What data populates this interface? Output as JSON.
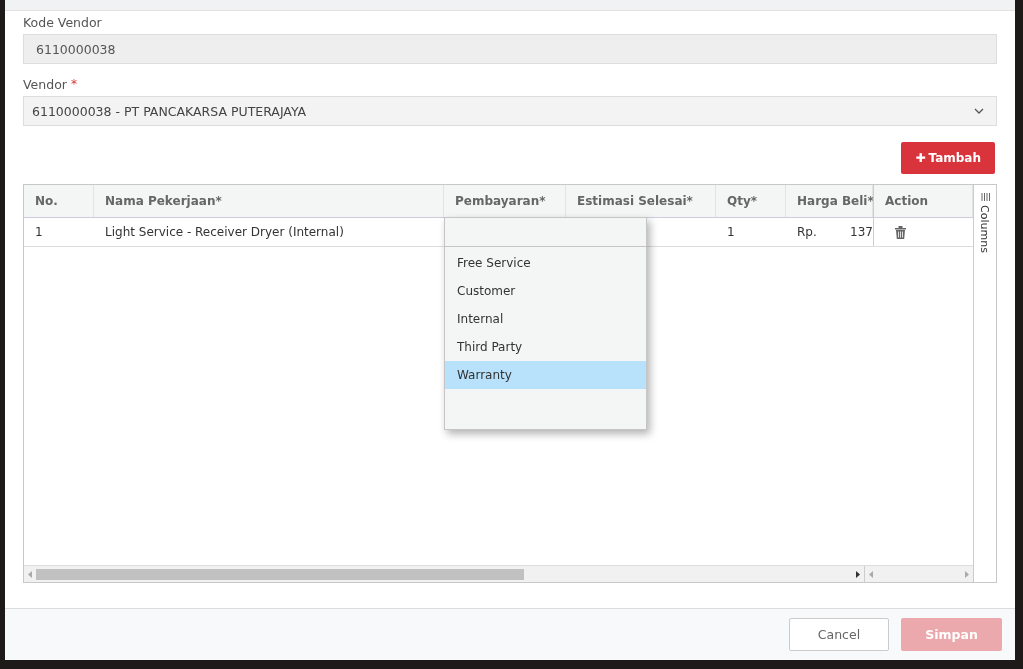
{
  "form": {
    "kode_vendor": {
      "label": "Kode Vendor",
      "value": "6110000038"
    },
    "vendor": {
      "label": "Vendor",
      "required_mark": "*",
      "value": "6110000038 - PT PANCAKARSA PUTERAJAYA"
    }
  },
  "add_button": {
    "icon": "✚",
    "label": "Tambah"
  },
  "table": {
    "columns": [
      "No.",
      "Nama Pekerjaan*",
      "Pembayaran*",
      "Estimasi Selesai*",
      "Qty*",
      "Harga Beli*",
      "Action"
    ],
    "rows": [
      {
        "no": "1",
        "nama_pekerjaan": "Light Service - Receiver Dryer (Internal)",
        "pembayaran": "",
        "estimasi_selesai": "",
        "qty": "1",
        "harga_currency": "Rp.",
        "harga_value": "137"
      }
    ],
    "columns_panel": "Columns"
  },
  "dropdown": {
    "options": [
      {
        "label": "Free Service",
        "selected": false
      },
      {
        "label": "Customer",
        "selected": false
      },
      {
        "label": "Internal",
        "selected": false
      },
      {
        "label": "Third Party",
        "selected": false
      },
      {
        "label": "Warranty",
        "selected": true
      }
    ]
  },
  "footer": {
    "buttons": [
      {
        "label": "Cancel",
        "kind": "secondary",
        "disabled": false
      },
      {
        "label": "Simpan",
        "kind": "primary",
        "disabled": true
      }
    ]
  }
}
